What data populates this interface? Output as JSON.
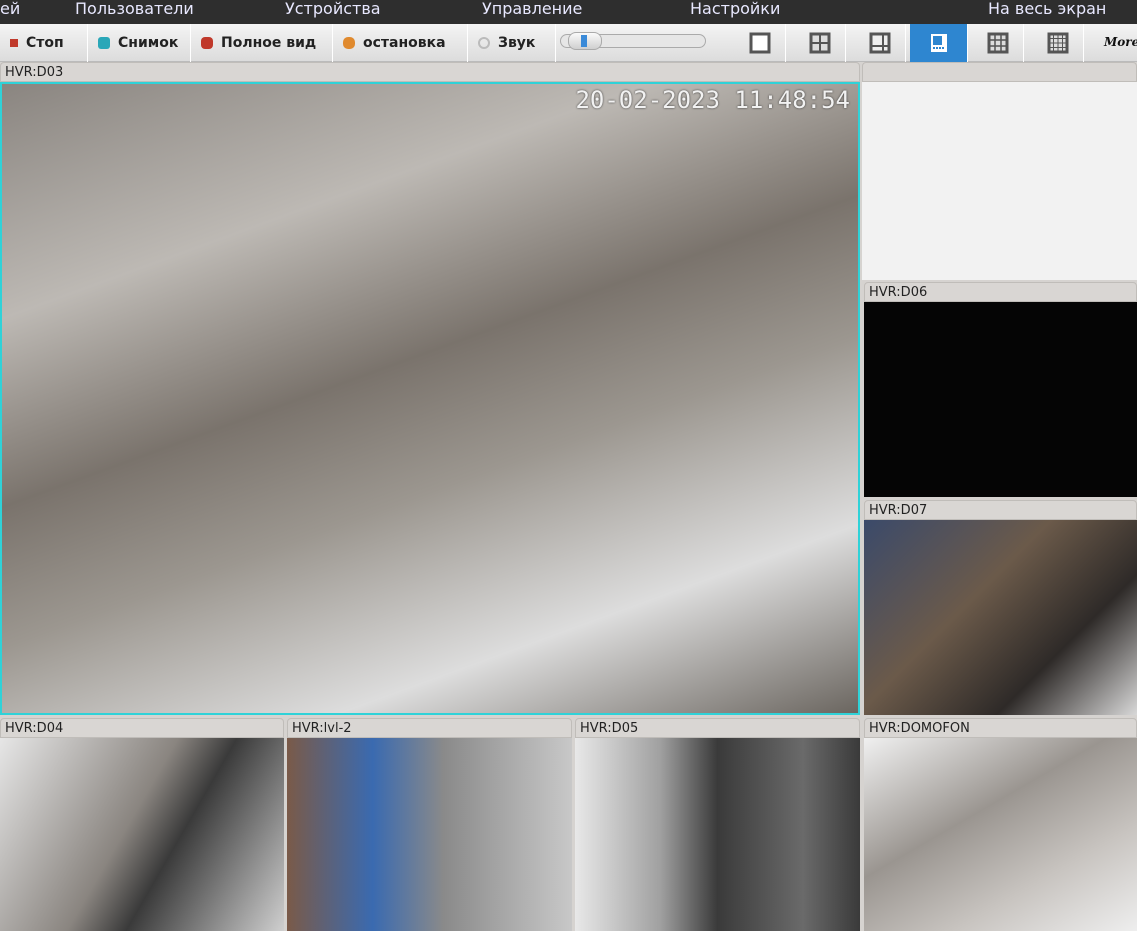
{
  "menu": [
    "ей",
    "Пользователи",
    "Устройства",
    "Управление",
    "Настройки",
    "На весь экран"
  ],
  "toolbar": {
    "stop": "Стоп",
    "snapshot": "Снимок",
    "full_video": "Полное вид",
    "stop_rec": "остановка",
    "sound": "Звук",
    "volume": 0.15,
    "more": "More",
    "active_layout": "1+7",
    "accent": "#2e86d0"
  },
  "tiles": {
    "main": {
      "label": "HVR:D03",
      "timestamp": "20-02-2023 11:48:54"
    },
    "d06": "HVR:D06",
    "d07": "HVR:D07",
    "d04": "HVR:D04",
    "lvl2": "HVR:lvl-2",
    "d05": "HVR:D05",
    "domofon": "HVR:DOMOFON"
  }
}
